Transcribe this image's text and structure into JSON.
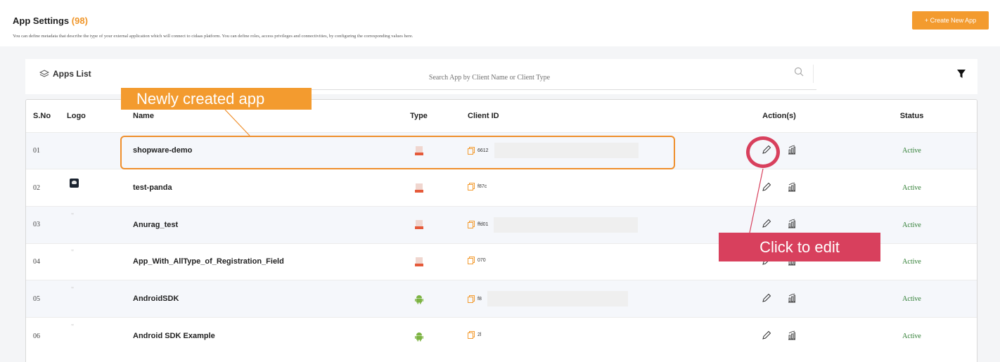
{
  "header": {
    "title": "App Settings",
    "count": "(98)",
    "description": "You can define metadata that describe the type of your external application which will connect to cidaas platform. You can define roles, access privileges and connectivities, by configuring the corresponding values here.",
    "create_button": "+ Create New App"
  },
  "list_bar": {
    "title": "Apps List",
    "search_placeholder": "Search App by Client Name or Client Type"
  },
  "table": {
    "columns": {
      "sno": "S.No",
      "logo": "Logo",
      "name": "Name",
      "type": "Type",
      "client_id": "Client ID",
      "actions": "Action(s)",
      "status": "Status"
    },
    "rows": [
      {
        "sno": "01",
        "logo": "",
        "name": "shopware-demo",
        "type": "html-icon",
        "client_id": "6612",
        "status": "Active"
      },
      {
        "sno": "02",
        "logo": "panda-logo",
        "name": "test-panda",
        "type": "html-icon",
        "client_id": "f87c",
        "status": "Active"
      },
      {
        "sno": "03",
        "logo": "quote",
        "name": "Anurag_test",
        "type": "html-icon",
        "client_id": "ffd01",
        "status": "Active"
      },
      {
        "sno": "04",
        "logo": "quote",
        "name": "App_With_AllType_of_Registration_Field",
        "type": "html-icon",
        "client_id": "070",
        "status": "Active"
      },
      {
        "sno": "05",
        "logo": "quote",
        "name": "AndroidSDK",
        "type": "android-icon",
        "client_id": "f8",
        "status": "Active"
      },
      {
        "sno": "06",
        "logo": "quote",
        "name": "Android SDK Example",
        "type": "android-icon",
        "client_id": "2l",
        "status": "Active"
      }
    ]
  },
  "annotations": {
    "new_app_label": "Newly created app",
    "edit_label": "Click to edit"
  },
  "colors": {
    "accent": "#f39b2f",
    "annotation_red": "#d8405d",
    "status_active": "#2e7d32"
  }
}
